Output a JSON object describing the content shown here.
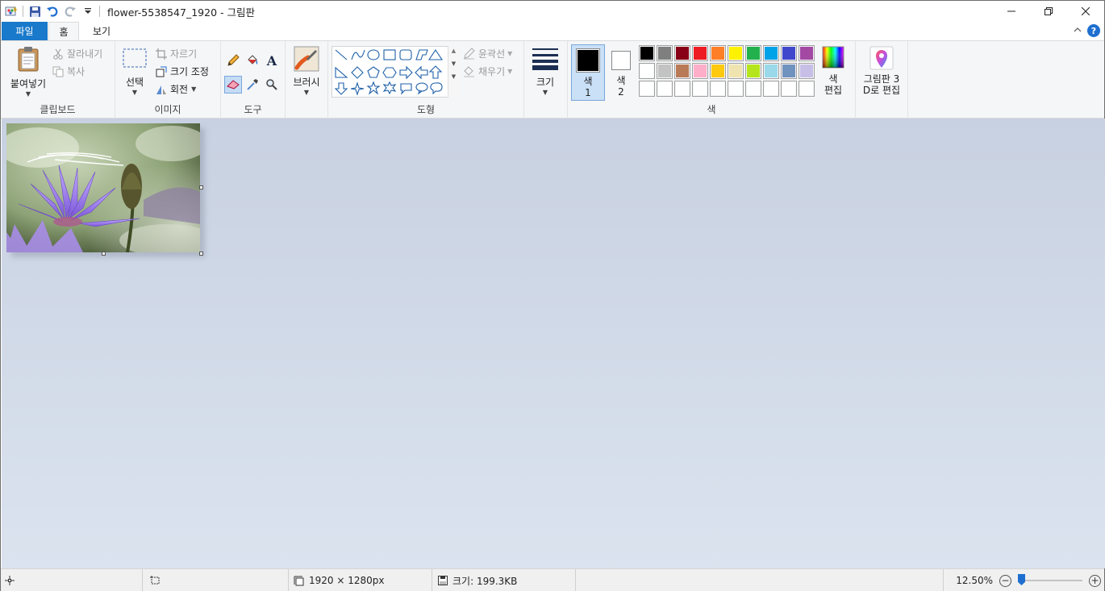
{
  "window": {
    "title": "flower-5538547_1920 - 그림판"
  },
  "tabs": {
    "file": "파일",
    "home": "홈",
    "view": "보기"
  },
  "clipboard": {
    "paste": "붙여넣기",
    "cut": "잘라내기",
    "copy": "복사",
    "label": "클립보드"
  },
  "image": {
    "select": "선택",
    "crop": "자르기",
    "resize": "크기 조정",
    "rotate": "회전",
    "label": "이미지"
  },
  "tools": {
    "label": "도구"
  },
  "brushes": {
    "label": "브러시"
  },
  "shapes": {
    "outline": "윤곽선",
    "fill": "채우기",
    "label": "도형"
  },
  "size": {
    "label": "크기"
  },
  "colors": {
    "color1_label_1": "색",
    "color1_label_2": "1",
    "color2_label_1": "색",
    "color2_label_2": "2",
    "edit_1": "색",
    "edit_2": "편집",
    "label": "색",
    "color1_value": "#000000",
    "color2_value": "#ffffff",
    "palette_row1": [
      "#000000",
      "#7f7f7f",
      "#880015",
      "#ed1c24",
      "#ff7f27",
      "#fff200",
      "#22b14c",
      "#00a2e8",
      "#3f48cc",
      "#a349a4"
    ],
    "palette_row2": [
      "#ffffff",
      "#c3c3c3",
      "#b97a57",
      "#ffaec9",
      "#ffc90e",
      "#efe4b0",
      "#b5e61d",
      "#99d9ea",
      "#7092be",
      "#c8bfe7"
    ],
    "palette_row3_count_note": "empty"
  },
  "paint3d": {
    "line1": "그림판 3",
    "line2": "D로 편집"
  },
  "status": {
    "dimensions": "1920 × 1280px",
    "file_size": "크기: 199.3KB",
    "zoom": "12.50%",
    "zoom_level": 0.125
  }
}
